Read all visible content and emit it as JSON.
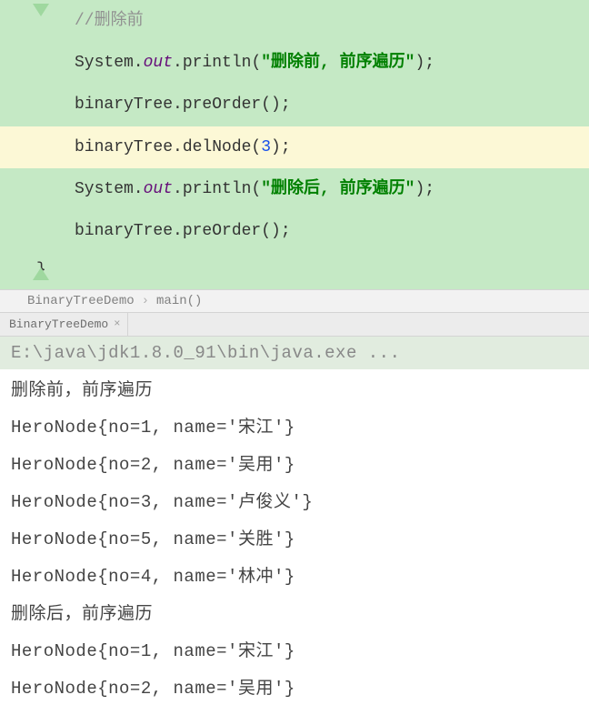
{
  "code": {
    "comment": "//删除前",
    "line2_a": "System.",
    "line2_b": "out",
    "line2_c": ".println(",
    "line2_d": "\"删除前, 前序遍历\"",
    "line2_e": ");",
    "line3": "binaryTree.preOrder();",
    "line4_a": "binaryTree.delNode(",
    "line4_b": "3",
    "line4_c": ");",
    "line5_a": "System.",
    "line5_b": "out",
    "line5_c": ".println(",
    "line5_d": "\"删除后, 前序遍历\"",
    "line5_e": ");",
    "line6": "binaryTree.preOrder();",
    "brace": "}"
  },
  "breadcrumb": {
    "class": "BinaryTreeDemo",
    "method": "main()"
  },
  "tab": {
    "label": "BinaryTreeDemo"
  },
  "console": {
    "cmd": "E:\\java\\jdk1.8.0_91\\bin\\java.exe ...",
    "lines": [
      "删除前，前序遍历",
      "HeroNode{no=1, name='宋江'}",
      "HeroNode{no=2, name='吴用'}",
      "HeroNode{no=3, name='卢俊义'}",
      "HeroNode{no=5, name='关胜'}",
      "HeroNode{no=4, name='林冲'}",
      "删除后，前序遍历",
      "HeroNode{no=1, name='宋江'}",
      "HeroNode{no=2, name='吴用'}"
    ]
  }
}
